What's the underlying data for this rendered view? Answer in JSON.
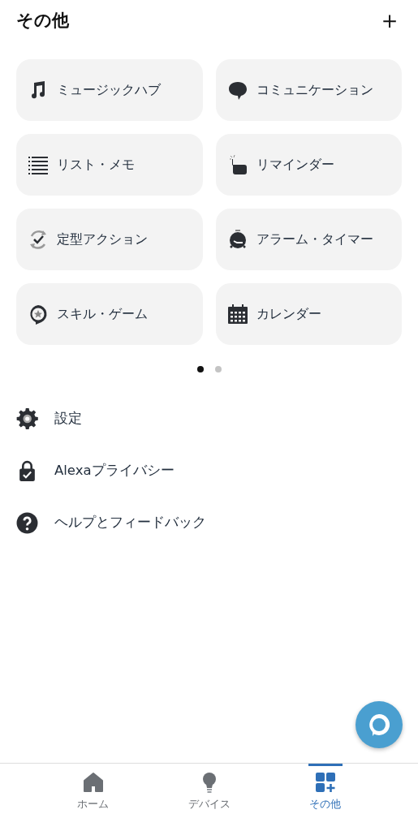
{
  "header": {
    "title": "その他",
    "add_button": "＋"
  },
  "cards": [
    {
      "label": "ミュージックハブ"
    },
    {
      "label": "コミュニケーション"
    },
    {
      "label": "リスト・メモ"
    },
    {
      "label": "リマインダー"
    },
    {
      "label": "定型アクション"
    },
    {
      "label": "アラーム・タイマー"
    },
    {
      "label": "スキル・ゲーム"
    },
    {
      "label": "カレンダー"
    }
  ],
  "pager": [
    {
      "selected": true
    },
    {
      "selected": false
    }
  ],
  "menu": [
    {
      "label": "設定"
    },
    {
      "label": "Alexaプライバシー"
    },
    {
      "label": "ヘルプとフィードバック"
    }
  ],
  "tabs": [
    {
      "label": "ホーム",
      "selected": false
    },
    {
      "label": "デバイス",
      "selected": false
    },
    {
      "label": "その他",
      "selected": true
    }
  ]
}
